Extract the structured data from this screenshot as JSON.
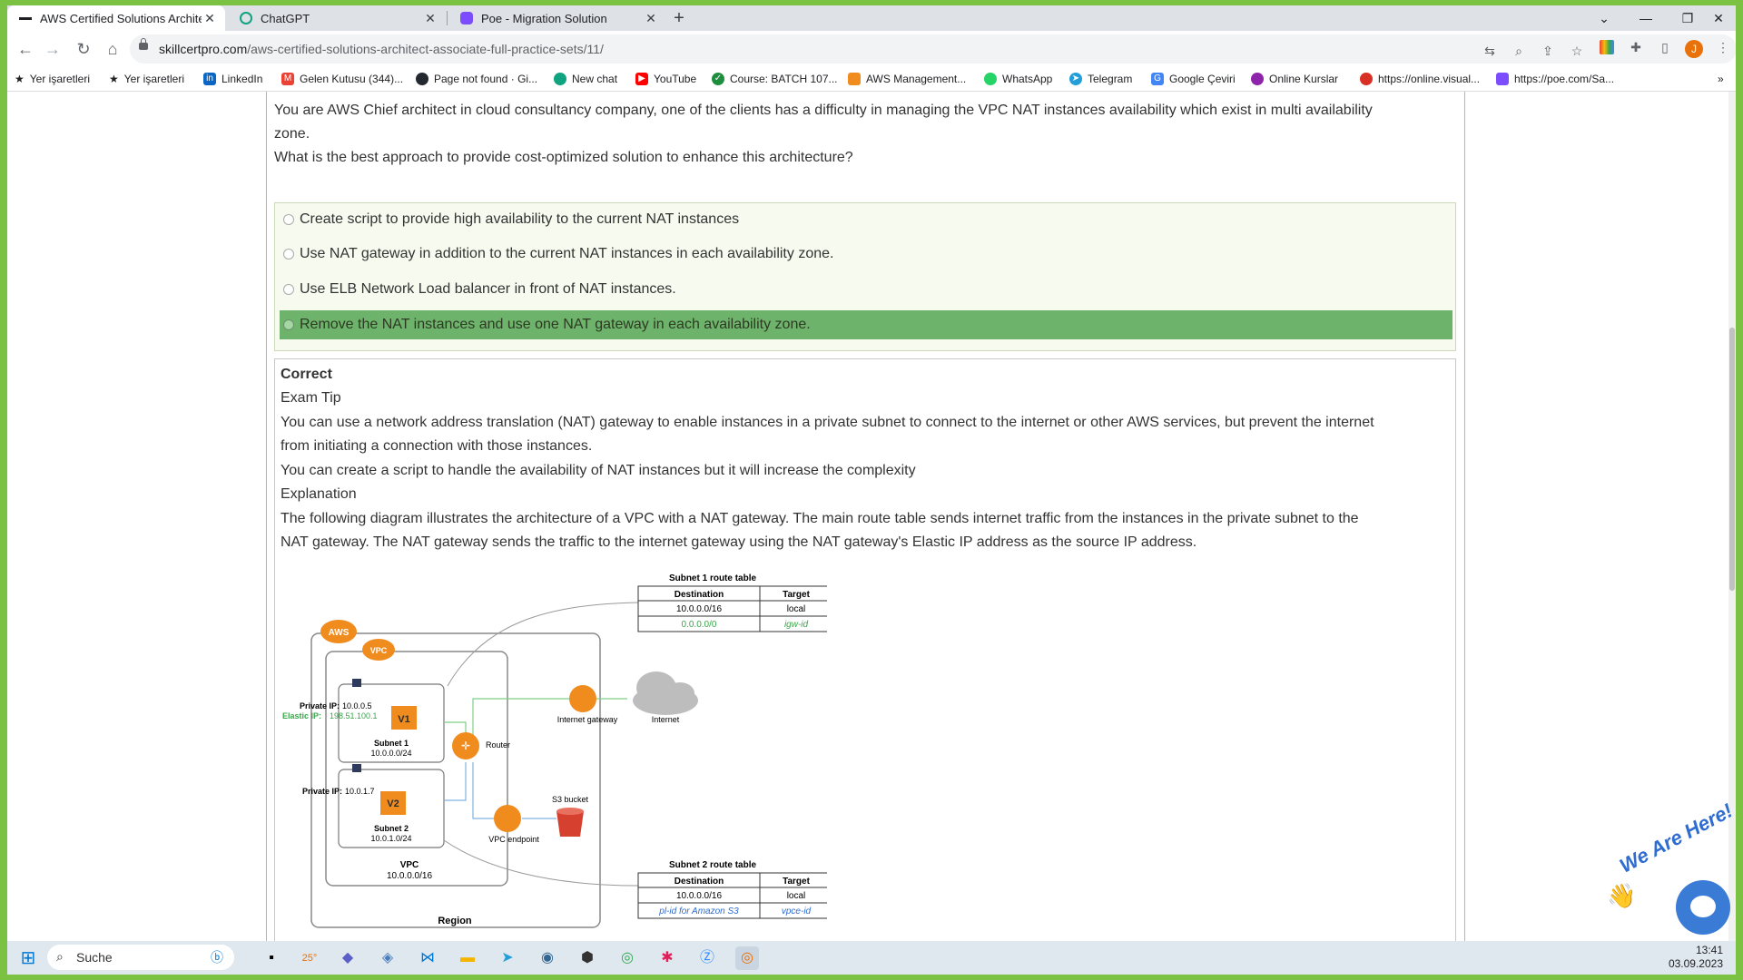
{
  "browser": {
    "tabs": [
      {
        "title": "AWS Certified Solutions Architect",
        "active": true
      },
      {
        "title": "ChatGPT",
        "active": false
      },
      {
        "title": "Poe - Migration Solution",
        "active": false
      }
    ],
    "url_host": "skillcertpro.com",
    "url_path": "/aws-certified-solutions-architect-associate-full-practice-sets/11/",
    "avatar_letter": "J"
  },
  "bookmarks": [
    "Yer işaretleri",
    "Yer işaretleri",
    "LinkedIn",
    "Gelen Kutusu (344)...",
    "Page not found · Gi...",
    "New chat",
    "YouTube",
    "Course: BATCH 107...",
    "AWS Management...",
    "WhatsApp",
    "Telegram",
    "Google Çeviri",
    "Online Kurslar",
    "https://online.visual...",
    "https://poe.com/Sa..."
  ],
  "question": {
    "line1": "You are AWS Chief architect in cloud consultancy company, one of the clients has a difficulty in managing the VPC NAT instances availability which exist in multi availability",
    "line2": "zone.",
    "line3": "What is the best approach to provide cost-optimized solution to enhance this architecture?",
    "options": [
      "Create script to provide high availability to the current NAT instances",
      "Use NAT gateway in addition to the current NAT instances in each availability zone.",
      "Use ELB Network Load balancer in front of NAT instances.",
      "Remove the NAT instances and use one NAT gateway in each availability zone."
    ],
    "correct_index": 3
  },
  "explanation": {
    "result": "Correct",
    "tip_heading": "Exam Tip",
    "tip1a": "You can use a network address translation (NAT) gateway to enable instances in a private subnet to connect to the internet or other AWS services, but prevent the internet",
    "tip1b": "from initiating a connection with those instances.",
    "tip2": "You can create a script to handle the availability of NAT instances but it will increase the complexity",
    "exp_heading": "Explanation",
    "exp1a": "The following diagram illustrates the architecture of a VPC with a NAT gateway. The main route table sends internet traffic from the instances in the private subnet to the",
    "exp1b": "NAT gateway. The NAT gateway sends the traffic to the internet gateway using the NAT gateway's Elastic IP address as the source IP address."
  },
  "diagram": {
    "aws": "AWS",
    "vpc_badge": "VPC",
    "rt1_title": "Subnet 1 route table",
    "rt2_title": "Subnet 2 route table",
    "col_dest": "Destination",
    "col_target": "Target",
    "rt1_rows": [
      [
        "10.0.0.0/16",
        "local"
      ],
      [
        "0.0.0.0/0",
        "igw-id"
      ]
    ],
    "rt2_rows": [
      [
        "10.0.0.0/16",
        "local"
      ],
      [
        "pl-id for Amazon S3",
        "vpce-id"
      ]
    ],
    "private_ip1_label": "Private IP:",
    "private_ip1": "10.0.0.5",
    "elastic_ip_label": "Elastic IP:",
    "elastic_ip": "198.51.100.1",
    "private_ip2_label": "Private IP:",
    "private_ip2": "10.0.1.7",
    "v1": "V1",
    "v2": "V2",
    "subnet1": "Subnet 1",
    "subnet1_cidr": "10.0.0.0/24",
    "subnet2": "Subnet 2",
    "subnet2_cidr": "10.0.1.0/24",
    "vpc": "VPC",
    "vpc_cidr": "10.0.0.0/16",
    "region": "Region",
    "router": "Router",
    "igw": "Internet gateway",
    "internet": "Internet",
    "s3": "S3 bucket",
    "vpce": "VPC endpoint"
  },
  "widget": {
    "text": "We Are Here!"
  },
  "taskbar": {
    "search": "Suche",
    "time": "13:41",
    "date": "03.09.2023",
    "weather": "25°"
  },
  "colors": {
    "correct_bg": "#6db36b",
    "aws_orange": "#f08c1e",
    "chrome_green_border": "#7bc142"
  }
}
